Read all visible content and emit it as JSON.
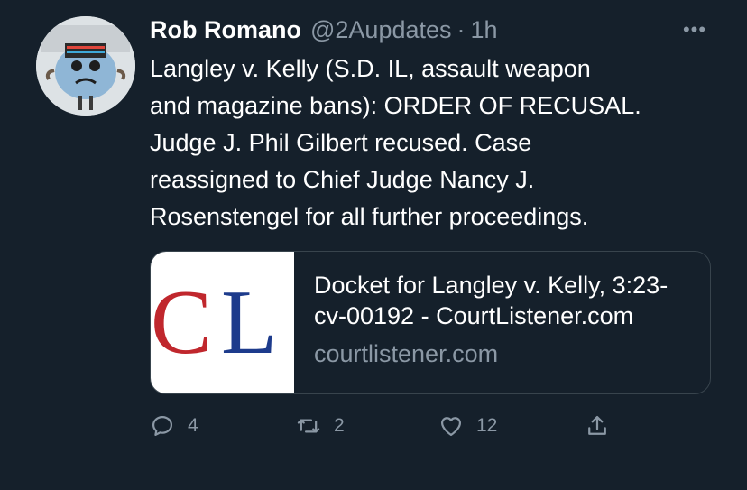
{
  "tweet": {
    "author_name": "Rob Romano",
    "handle": "@2Aupdates",
    "separator": "·",
    "time": "1h",
    "more_label": "•••",
    "text": "Langley v. Kelly (S.D. IL, assault weapon\nand magazine bans): ORDER OF RECUSAL.\nJudge J. Phil Gilbert recused. Case\nreassigned to Chief Judge Nancy J.\nRosenstengel for all further proceedings.",
    "card": {
      "logo_text": "CL",
      "logo_colors": {
        "C": "#c0272d",
        "L": "#1d3b8c"
      },
      "title": "Docket for Langley v. Kelly, 3:23-cv-00192 - CourtListener.com",
      "domain": "courtlistener.com"
    },
    "actions": {
      "reply": {
        "icon": "reply-icon",
        "count": "4"
      },
      "retweet": {
        "icon": "retweet-icon",
        "count": "2"
      },
      "like": {
        "icon": "heart-icon",
        "count": "12"
      },
      "share": {
        "icon": "share-icon"
      }
    }
  },
  "colors": {
    "background": "#15202b",
    "text_primary": "#ffffff",
    "text_secondary": "#8b98a5",
    "border": "#38444d"
  }
}
